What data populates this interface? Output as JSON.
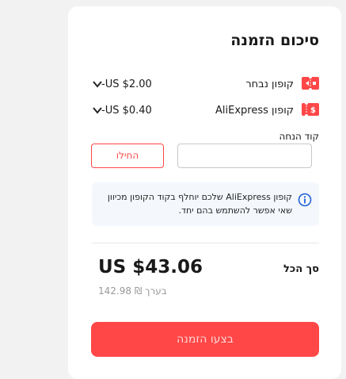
{
  "summary": {
    "title": "סיכום הזמנה",
    "selected_coupon": {
      "label": "קופון נבחר",
      "amount": "-US $2.00",
      "icon": "coupon-ticket-icon"
    },
    "aliexpress_coupon": {
      "label": "קופון AliExpress",
      "amount": "-US $0.40",
      "icon": "coupon-dollar-icon"
    },
    "promo_code": {
      "label": "קוד הנחה",
      "value": "",
      "apply_label": "החילו"
    },
    "notice": {
      "icon": "info-icon",
      "text": "קופון AliExpress שלכם יוחלף בקוד הקופון מכיוון שאי אפשר להשתמש בהם יחד."
    },
    "total": {
      "label": "סך הכל",
      "amount": "US $43.06",
      "approx": "בערך ₪ 142.98"
    },
    "place_order_label": "בצעו הזמנה"
  },
  "colors": {
    "accent": "#ff4747",
    "notice_bg": "#f4f8fd",
    "info_blue": "#1f5fd6"
  }
}
